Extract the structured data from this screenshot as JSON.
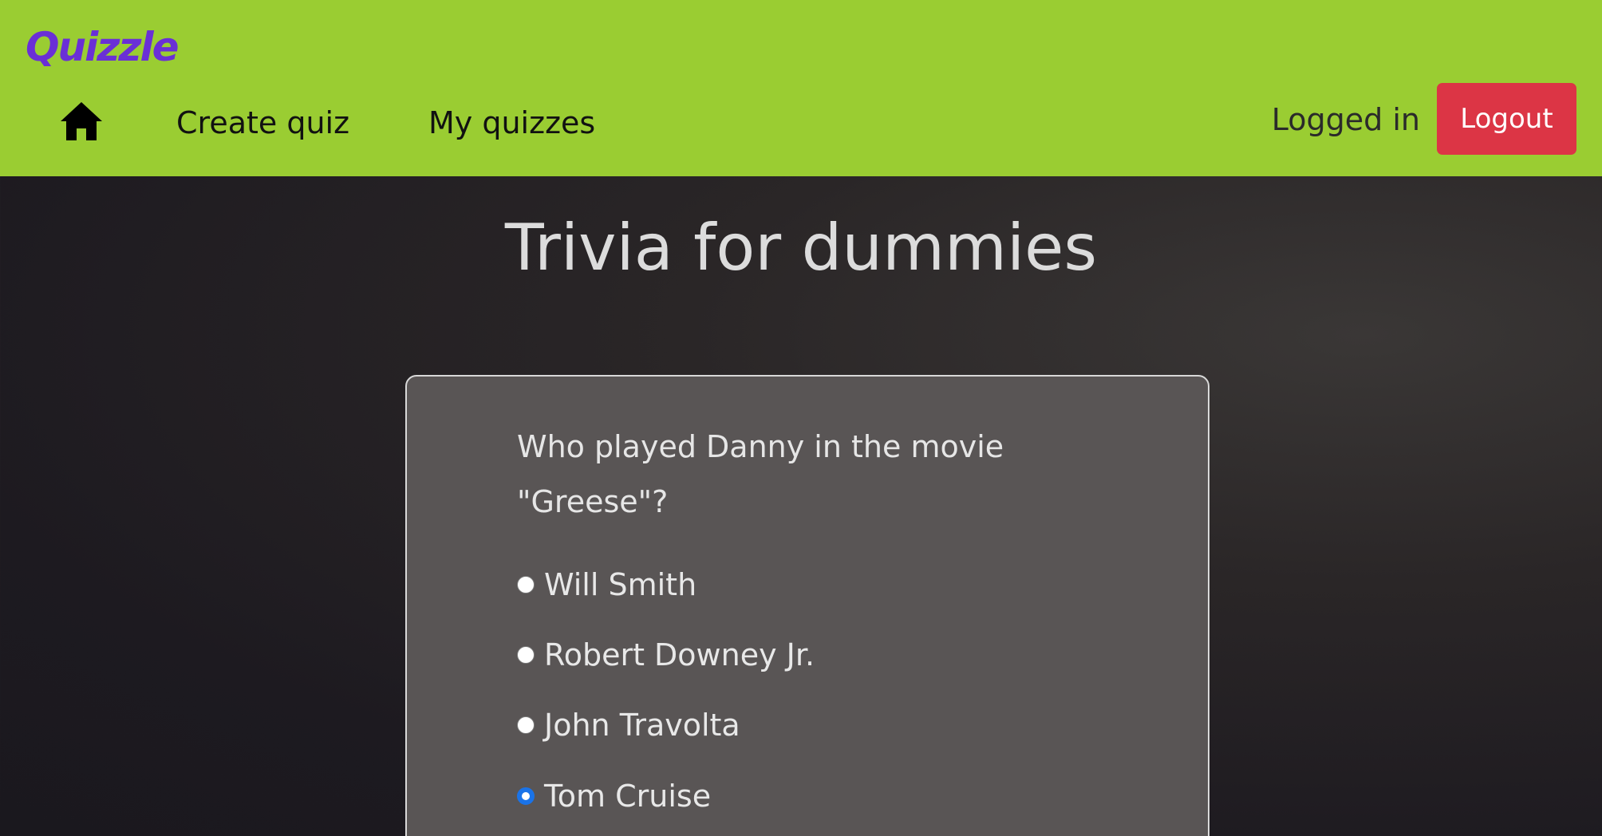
{
  "brand": {
    "name": "Quizzle",
    "color": "#6a2fd6"
  },
  "navbar": {
    "background": "#9acd32",
    "home_icon": "home-icon",
    "links": [
      {
        "label": "Create quiz"
      },
      {
        "label": "My quizzes"
      }
    ],
    "status_text": "Logged in",
    "logout_label": "Logout",
    "logout_color": "#dc3545"
  },
  "page": {
    "title": "Trivia for dummies"
  },
  "question": {
    "text": "Who played Danny in the movie \"Greese\"?",
    "options": [
      {
        "label": "Will Smith",
        "selected": false
      },
      {
        "label": "Robert Downey Jr.",
        "selected": false
      },
      {
        "label": "John Travolta",
        "selected": false
      },
      {
        "label": "Tom Cruise",
        "selected": true
      }
    ],
    "selected_color": "#1a73e8"
  }
}
